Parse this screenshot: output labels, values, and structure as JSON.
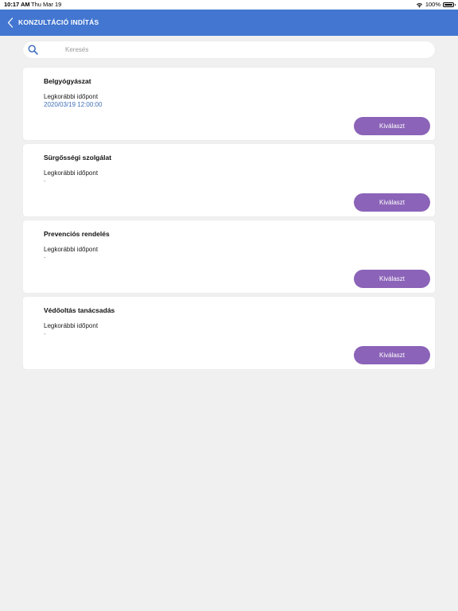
{
  "status_bar": {
    "time": "10:17 AM",
    "date": "Thu Mar 19",
    "battery": "100%"
  },
  "nav": {
    "title": "KONZULTÁCIÓ INDÍTÁS",
    "back_icon": "chevron-left-icon"
  },
  "search": {
    "placeholder": "Keresés",
    "icon": "search-icon"
  },
  "cards": [
    {
      "title": "Belgyógyászat",
      "label": "Legkorábbi időpont",
      "value": "2020/03/19 12:00:00",
      "button": "Kiválaszt"
    },
    {
      "title": "Sürgősségi szolgálat",
      "label": "Legkorábbi időpont",
      "value": "-",
      "button": "Kiválaszt"
    },
    {
      "title": "Prevenciós rendelés",
      "label": "Legkorábbi időpont",
      "value": "-",
      "button": "Kiválaszt"
    },
    {
      "title": "Védőoltás tanácsadás",
      "label": "Legkorábbi időpont",
      "value": "-",
      "button": "Kiválaszt"
    }
  ],
  "colors": {
    "nav_background": "#4276d0",
    "button_background": "#8b63b8",
    "date_text": "#3f6fb8",
    "page_background": "#f0f0f0"
  }
}
